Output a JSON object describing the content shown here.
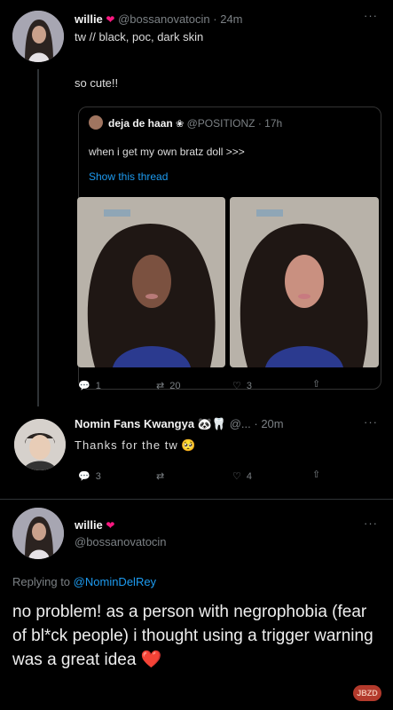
{
  "tweet1": {
    "name": "willie",
    "handle": "@bossanovatocin",
    "time": "· 24m",
    "line1": "tw // black, poc, dark skin",
    "line2": "so cute!!"
  },
  "quote": {
    "name": "deja de haan",
    "handle": "@POSITIONZ",
    "time": "· 17h",
    "text": "when i get my own bratz doll >>>",
    "link": "Show this thread",
    "actions": {
      "reply": "1",
      "retweet": "20",
      "like": "3"
    }
  },
  "reply": {
    "name": "Nomin Fans Kwangya",
    "handle": "@...",
    "time": "· 20m",
    "text": "Thanks for the tw",
    "actions": {
      "reply": "3",
      "like": "4"
    }
  },
  "tweet3": {
    "name": "willie",
    "handle": "@bossanovatocin",
    "replying_label": "Replying to",
    "replying_handle": "@NominDelRey",
    "text": "no problem! as a person with negrophobia (fear of bl*ck people) i thought using a trigger warning was a great idea"
  },
  "watermark": "JBZD",
  "colors": {
    "background": "#000000",
    "link": "#1d9bf0",
    "heart": "#f91880"
  }
}
